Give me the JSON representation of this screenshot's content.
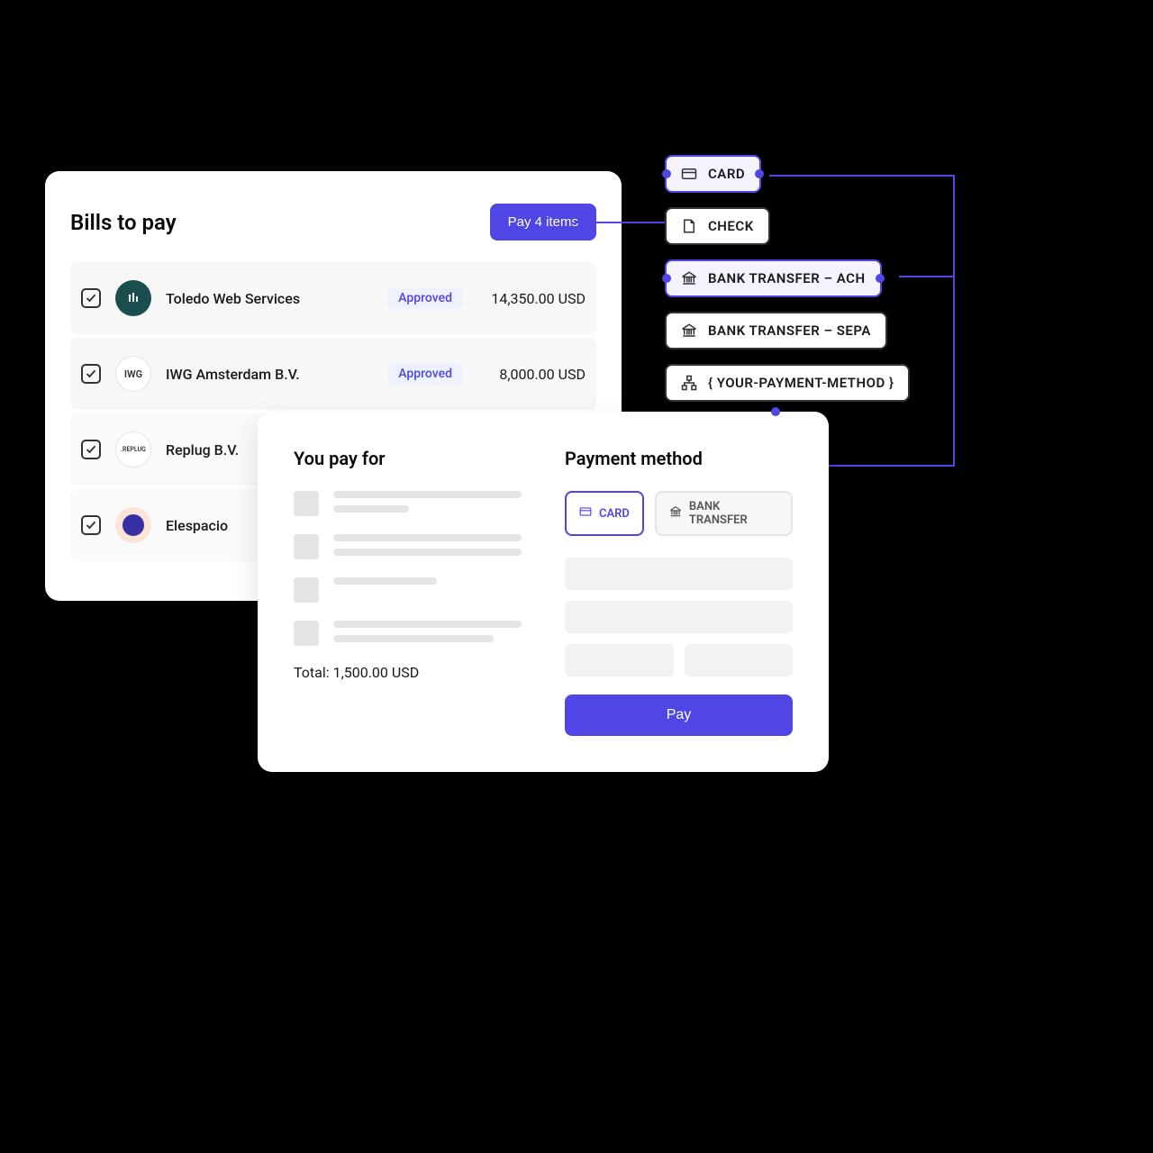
{
  "bills": {
    "title": "Bills to pay",
    "pay_button": "Pay 4 items",
    "items": [
      {
        "vendor": "Toledo Web Services",
        "status": "Approved",
        "amount": "14,350.00 USD"
      },
      {
        "vendor": "IWG Amsterdam B.V.",
        "status": "Approved",
        "amount": "8,000.00 USD"
      },
      {
        "vendor": "Replug B.V.",
        "status": "",
        "amount": ""
      },
      {
        "vendor": "Elespacio",
        "status": "",
        "amount": ""
      }
    ]
  },
  "methods": {
    "card": "CARD",
    "check": "CHECK",
    "ach": "BANK TRANSFER – ACH",
    "sepa": "BANK TRANSFER – SEPA",
    "custom": "{ YOUR-PAYMENT-METHOD }"
  },
  "panel": {
    "pay_for_title": "You pay for",
    "method_title": "Payment method",
    "total": "Total: 1,500.00 USD",
    "tab_card": "CARD",
    "tab_bank": "BANK TRANSFER",
    "pay_button": "Pay"
  }
}
